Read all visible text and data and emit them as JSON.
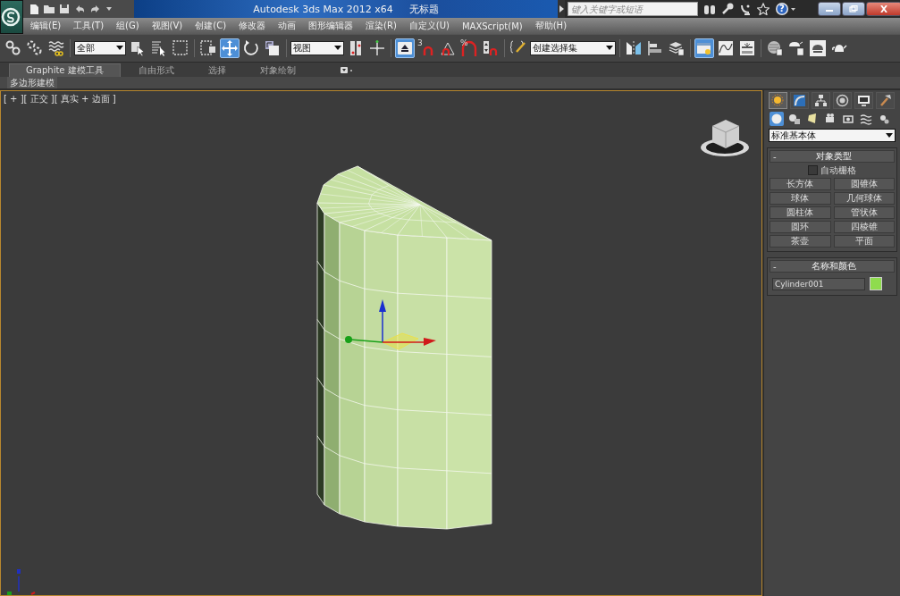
{
  "app": {
    "title": "Autodesk 3ds Max  2012 x64",
    "document": "无标题",
    "search": {
      "placeholder": "键入关键字或短语"
    },
    "help": "?"
  },
  "menu": [
    "编辑(E)",
    "工具(T)",
    "组(G)",
    "视图(V)",
    "创建(C)",
    "修改器",
    "动画",
    "图形编辑器",
    "渲染(R)",
    "自定义(U)",
    "MAXScript(M)",
    "帮助(H)"
  ],
  "toolbar": [
    {
      "kind": "icon",
      "selected": false
    },
    {
      "kind": "icon",
      "selected": false
    },
    {
      "kind": "icon",
      "selected": false
    },
    {
      "kind": "dropdown",
      "value": "全部"
    },
    {
      "kind": "icon",
      "selected": false
    },
    {
      "kind": "icon",
      "selected": false
    },
    {
      "kind": "icon",
      "selected": false
    },
    {
      "kind": "icon",
      "selected": false
    },
    {
      "kind": "icon",
      "selected": true
    },
    {
      "kind": "icon",
      "selected": false
    },
    {
      "kind": "icon",
      "selected": false
    },
    {
      "kind": "dropdown",
      "value": "视图"
    },
    {
      "kind": "icon",
      "selected": false
    },
    {
      "kind": "icon",
      "selected": false
    },
    {
      "kind": "icon",
      "selected": true
    },
    {
      "kind": "icon",
      "selected": false,
      "label": "3"
    },
    {
      "kind": "icon",
      "selected": false
    },
    {
      "kind": "icon",
      "selected": false,
      "label": "%"
    },
    {
      "kind": "icon",
      "selected": false
    },
    {
      "kind": "icon",
      "selected": false
    },
    {
      "kind": "dropdown",
      "value": "创建选择集"
    },
    {
      "kind": "icon",
      "selected": false
    },
    {
      "kind": "icon",
      "selected": false
    },
    {
      "kind": "icon",
      "selected": false
    },
    {
      "kind": "icon",
      "selected": true
    },
    {
      "kind": "icon",
      "selected": false
    },
    {
      "kind": "icon",
      "selected": false
    },
    {
      "kind": "icon",
      "selected": false
    },
    {
      "kind": "icon",
      "selected": false
    },
    {
      "kind": "icon",
      "selected": false
    },
    {
      "kind": "icon",
      "selected": false
    }
  ],
  "ribbon_tabs": [
    {
      "label": "Graphite 建模工具",
      "selected": true
    },
    {
      "label": "自由形式",
      "selected": false
    },
    {
      "label": "选择",
      "selected": false
    },
    {
      "label": "对象绘制",
      "selected": false
    }
  ],
  "ribbon_panels": [
    "多边形建模"
  ],
  "viewport": {
    "label": "[ + ][ 正交 ][ 真实 + 边面 ]"
  },
  "command_panel": {
    "tabs": [
      {
        "selected": true
      },
      {
        "selected": false
      },
      {
        "selected": false
      },
      {
        "selected": false
      },
      {
        "selected": false
      },
      {
        "selected": false
      }
    ],
    "categories": [
      {
        "selected": true
      },
      {
        "selected": false
      },
      {
        "selected": false
      },
      {
        "selected": false
      },
      {
        "selected": false
      },
      {
        "selected": false
      },
      {
        "selected": false
      }
    ],
    "dropdown": "标准基本体",
    "object_type": {
      "toggle": "-",
      "title": "对象类型",
      "autogrid": {
        "label": "自动栅格",
        "checked": false
      },
      "buttons": [
        "长方体",
        "圆锥体",
        "球体",
        "几何球体",
        "圆柱体",
        "管状体",
        "圆环",
        "四棱锥",
        "茶壶",
        "平面"
      ]
    },
    "name_and_color": {
      "toggle": "-",
      "title": "名称和颜色",
      "name": "Cylinder001",
      "color": "#8fdc4e"
    }
  }
}
